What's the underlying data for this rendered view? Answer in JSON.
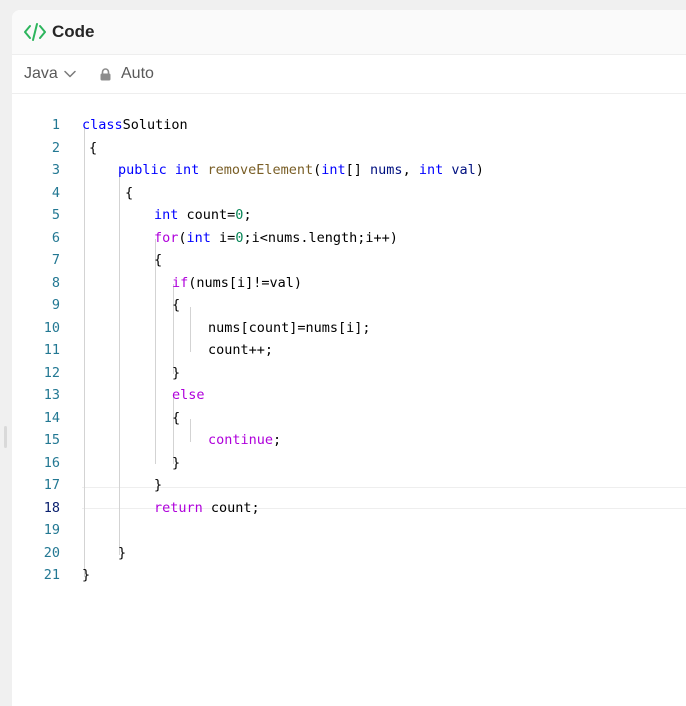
{
  "header": {
    "title": "Code",
    "icon": "code-icon"
  },
  "toolbar": {
    "language": "Java",
    "mode": "Auto"
  },
  "editor": {
    "active_line": 18,
    "lines": [
      {
        "n": "1",
        "t": [
          [
            "kw",
            "class"
          ],
          [
            "",
            "Solution"
          ]
        ]
      },
      {
        "n": "2",
        "t": [
          [
            "",
            "{"
          ]
        ]
      },
      {
        "n": "3",
        "t": [
          [
            "kw",
            "public"
          ],
          [
            "",
            " "
          ],
          [
            "kw",
            "int"
          ],
          [
            "",
            " "
          ],
          [
            "fn",
            "removeElement"
          ],
          [
            "",
            "("
          ],
          [
            "kw",
            "int"
          ],
          [
            "",
            "[] "
          ],
          [
            "var",
            "nums"
          ],
          [
            "",
            ", "
          ],
          [
            "kw",
            "int"
          ],
          [
            "",
            " "
          ],
          [
            "var",
            "val"
          ],
          [
            "",
            ")"
          ]
        ]
      },
      {
        "n": "4",
        "t": [
          [
            "",
            "{"
          ]
        ]
      },
      {
        "n": "5",
        "t": [
          [
            "kw",
            "int"
          ],
          [
            "",
            " count="
          ],
          [
            "num",
            "0"
          ],
          [
            "",
            ";"
          ]
        ]
      },
      {
        "n": "6",
        "t": [
          [
            "ctl",
            "for"
          ],
          [
            "",
            "("
          ],
          [
            "kw",
            "int"
          ],
          [
            "",
            " i="
          ],
          [
            "num",
            "0"
          ],
          [
            "",
            ";i<nums.length;i++)"
          ]
        ]
      },
      {
        "n": "7",
        "t": [
          [
            "",
            "{"
          ]
        ]
      },
      {
        "n": "8",
        "t": [
          [
            "ctl",
            "if"
          ],
          [
            "",
            "(nums[i]!=val)"
          ]
        ]
      },
      {
        "n": "9",
        "t": [
          [
            "",
            "{"
          ]
        ]
      },
      {
        "n": "10",
        "t": [
          [
            "",
            "nums[count]=nums[i];"
          ]
        ]
      },
      {
        "n": "11",
        "t": [
          [
            "",
            "count++;"
          ]
        ]
      },
      {
        "n": "12",
        "t": [
          [
            "",
            "}"
          ]
        ]
      },
      {
        "n": "13",
        "t": [
          [
            "ctl",
            "else"
          ]
        ]
      },
      {
        "n": "14",
        "t": [
          [
            "",
            "{"
          ]
        ]
      },
      {
        "n": "15",
        "t": [
          [
            "ctl",
            "continue"
          ],
          [
            "",
            ";"
          ]
        ]
      },
      {
        "n": "16",
        "t": [
          [
            "",
            "}"
          ]
        ]
      },
      {
        "n": "17",
        "t": [
          [
            "",
            "}"
          ]
        ]
      },
      {
        "n": "18",
        "t": [
          [
            "ctl",
            "return"
          ],
          [
            "",
            " count;"
          ]
        ]
      },
      {
        "n": "19",
        "t": []
      },
      {
        "n": "20",
        "t": [
          [
            "",
            "}"
          ]
        ]
      },
      {
        "n": "21",
        "t": [
          [
            "",
            "}"
          ]
        ]
      }
    ]
  }
}
